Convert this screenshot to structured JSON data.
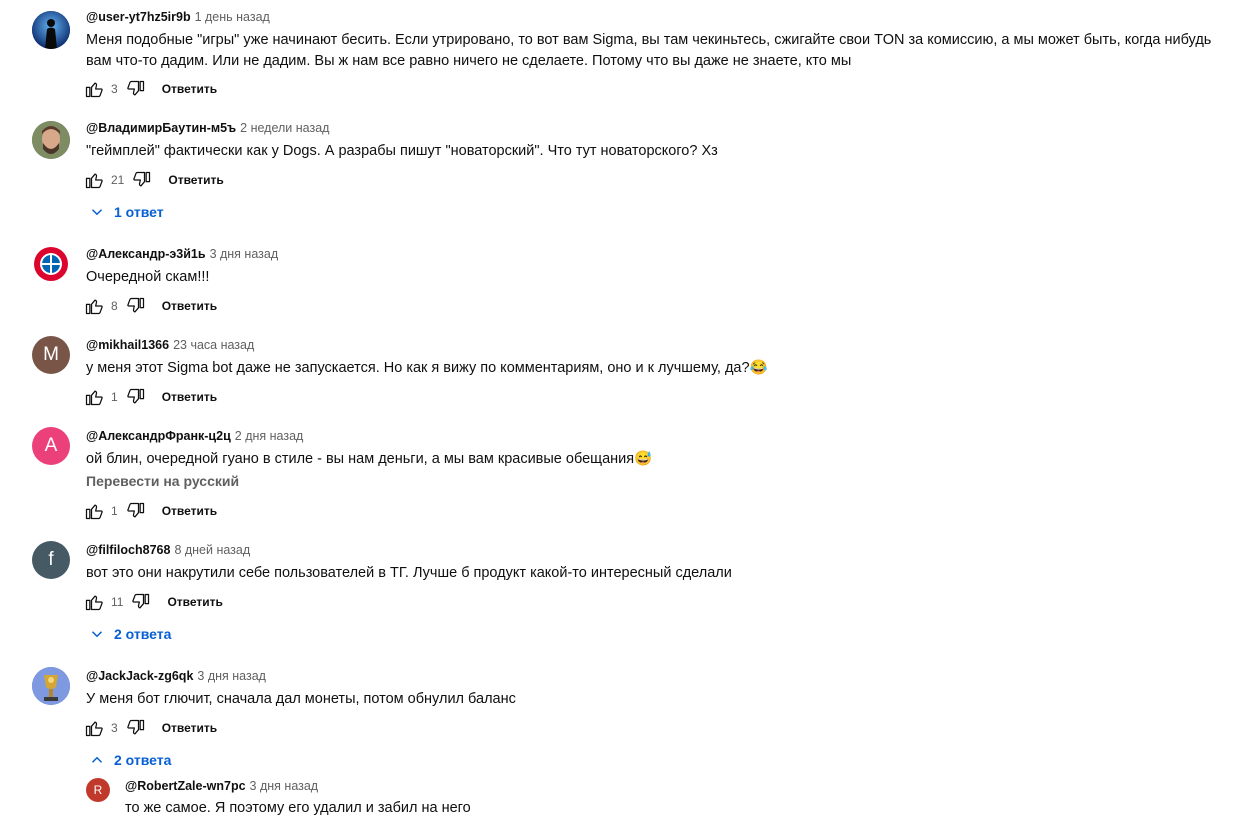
{
  "reply_label": "Ответить",
  "comments": [
    {
      "author": "@user-yt7hz5ir9b",
      "time": "1 день назад",
      "text": "Меня подобные \"игры\" уже начинают бесить. Если утрировано, то вот вам Sigma, вы там чекиньтесь, сжигайте свои TON за комиссию, а мы может быть, когда нибудь вам что-то дадим. Или не дадим. Вы ж нам все равно ничего не сделаете. Потому что вы даже не знаете, кто мы",
      "likes": "3"
    },
    {
      "author": "@ВладимирБаутин-м5ъ",
      "time": "2 недели назад",
      "text": "\"геймплей\" фактически как у Dogs. А разрабы пишут \"новаторский\". Что тут новаторского? Хз",
      "likes": "21",
      "replies_label": "1 ответ"
    },
    {
      "author": "@Александр-э3й1ь",
      "time": "3 дня назад",
      "text": "Очередной скам!!!",
      "likes": "8"
    },
    {
      "author": "@mikhail1366",
      "time": "23 часа назад",
      "text": "у меня этот Sigma bot даже не запускается. Но как я вижу по комментариям, оно и к лучшему, да?😂",
      "likes": "1",
      "avatar_letter": "M",
      "avatar_color": "#795548"
    },
    {
      "author": "@АлександрФранк-ц2ц",
      "time": "2 дня назад",
      "text": "ой блин, очередной гуано в стиле - вы нам деньги, а мы вам красивые обещания😅",
      "translate": "Перевести на русский",
      "likes": "1",
      "avatar_letter": "A",
      "avatar_color": "#ec407a"
    },
    {
      "author": "@filfiloch8768",
      "time": "8 дней назад",
      "text": "вот это они накрутили себе пользователей в ТГ. Лучше б продукт какой-то интересный сделали",
      "likes": "11",
      "replies_label": "2 ответа",
      "avatar_letter": "f",
      "avatar_color": "#455a64"
    },
    {
      "author": "@JackJack-zg6qk",
      "time": "3 дня назад",
      "text": "У меня бот глючит, сначала дал монеты, потом обнулил баланс",
      "likes": "3",
      "replies_label": "2 ответа"
    }
  ],
  "reply": {
    "author": "@RobertZale-wn7pc",
    "time": "3 дня назад",
    "text": "то же самое. Я поэтому его удалил и забил на него",
    "avatar_letter": "R",
    "avatar_color": "#c0392b"
  }
}
